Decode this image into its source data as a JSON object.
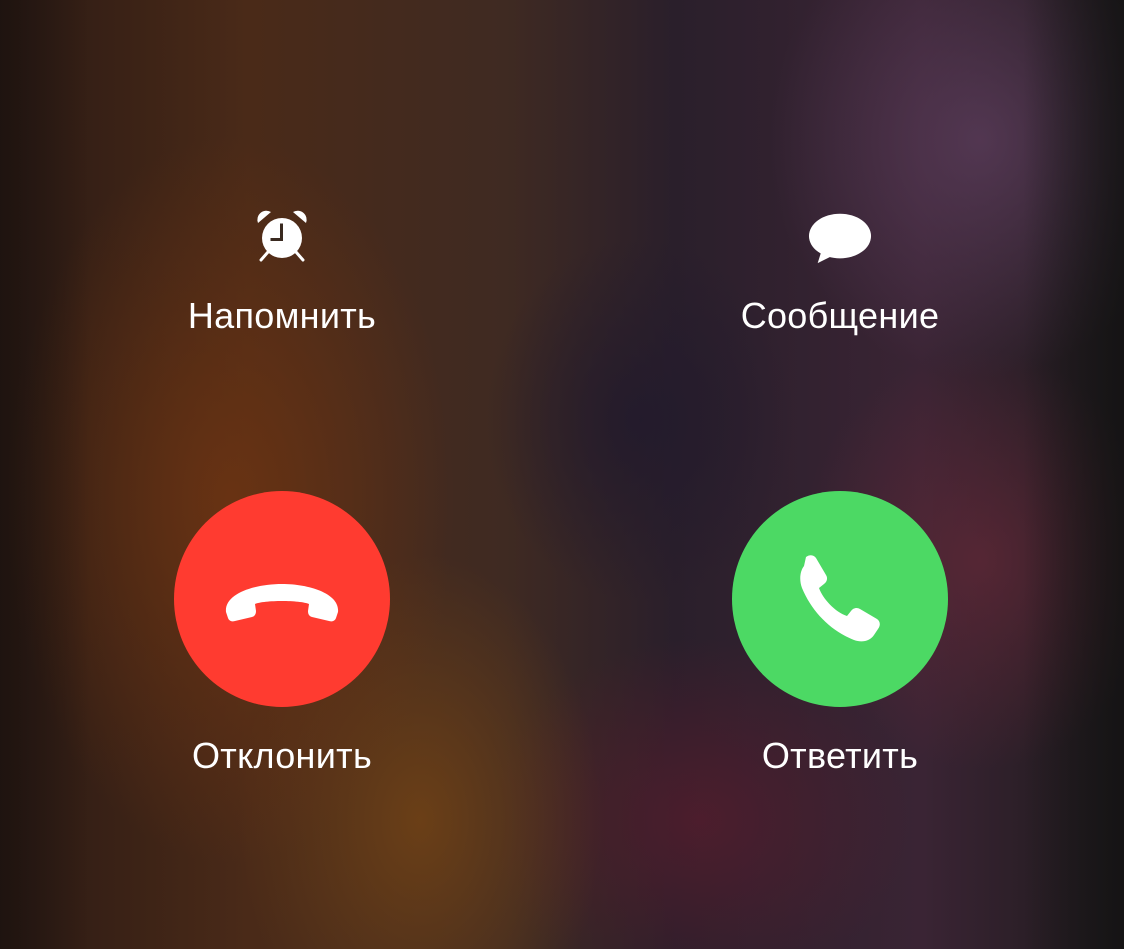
{
  "colors": {
    "decline": "#ff3b30",
    "accept": "#4cd964",
    "text": "#ffffff"
  },
  "actions": {
    "remind": {
      "label": "Напомнить",
      "icon": "alarm-clock-icon"
    },
    "message": {
      "label": "Сообщение",
      "icon": "speech-bubble-icon"
    }
  },
  "call_buttons": {
    "decline": {
      "label": "Отклонить",
      "icon": "phone-hangup-icon"
    },
    "accept": {
      "label": "Ответить",
      "icon": "phone-icon"
    }
  }
}
